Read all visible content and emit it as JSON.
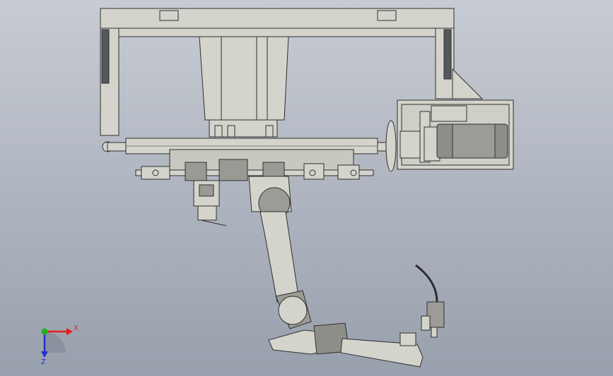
{
  "viewport": {
    "background_top": "#c7cbd3",
    "background_bottom": "#98a0ad"
  },
  "model": {
    "part_fill": "#d4d4cc",
    "part_stroke": "#2f2f2f",
    "shadow_fill": "#5e6068"
  },
  "triad": {
    "x_label": "X",
    "z_label": "Z",
    "x_color": "#e02020",
    "y_color": "#20b020",
    "z_color": "#2030d0"
  }
}
